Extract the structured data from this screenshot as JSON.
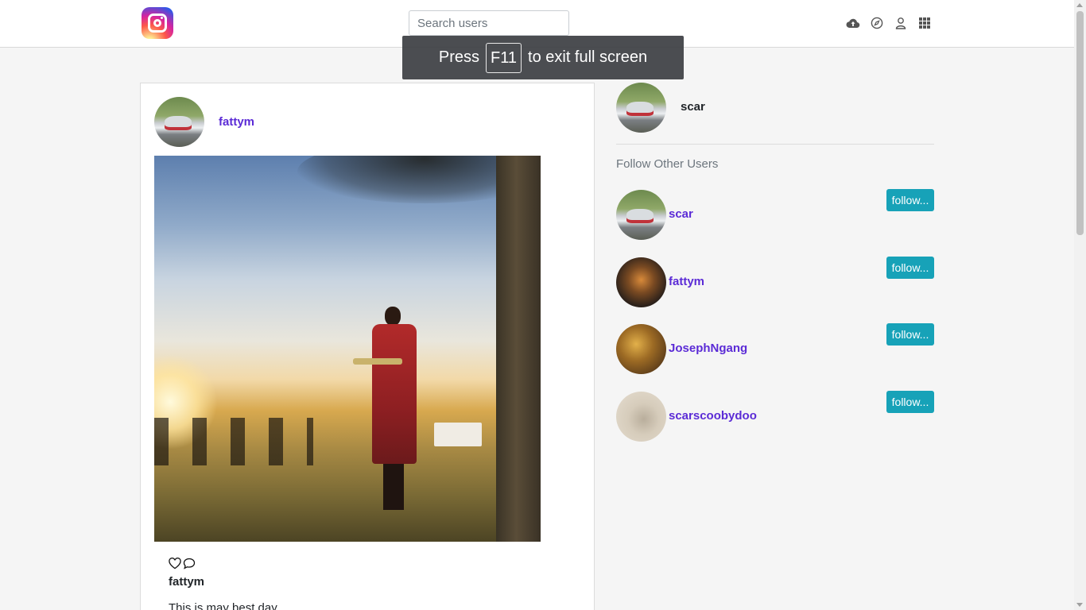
{
  "header": {
    "search_placeholder": "Search users",
    "icons": [
      "upload-cloud-icon",
      "compass-icon",
      "user-icon",
      "grid-icon"
    ]
  },
  "fullscreen_notice": {
    "before": "Press",
    "key": "F11",
    "after": "to exit full screen"
  },
  "post": {
    "username": "fattym",
    "caption_username": "fattym",
    "caption": "This is may best day"
  },
  "sidebar": {
    "current_user": "scar",
    "follow_title": "Follow Other Users",
    "suggestions": [
      {
        "username": "scar",
        "button": "follow..."
      },
      {
        "username": "fattym",
        "button": "follow..."
      },
      {
        "username": "JosephNgang",
        "button": "follow..."
      },
      {
        "username": "scarscoobydoo",
        "button": "follow..."
      }
    ]
  },
  "colors": {
    "link": "#5b2bd6",
    "follow_button": "#17a2b8",
    "background": "#f5f5f5"
  }
}
